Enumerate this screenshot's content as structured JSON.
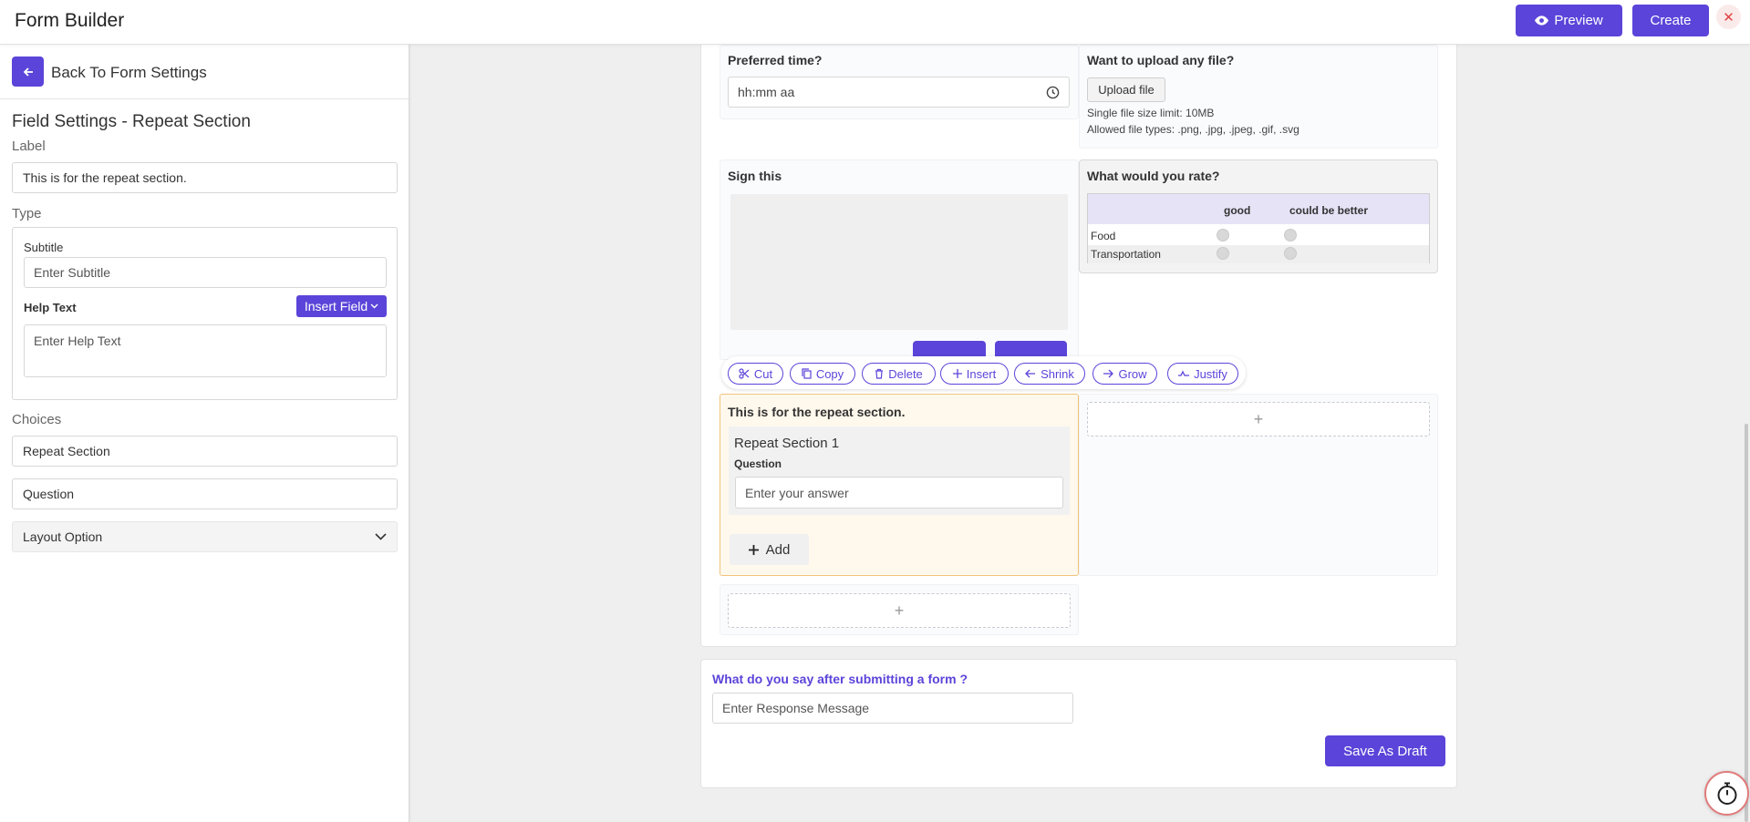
{
  "header": {
    "title": "Form Builder",
    "preview_label": "Preview",
    "create_label": "Create",
    "close_glyph": "✕"
  },
  "sidebar": {
    "back_label": "Back To Form Settings",
    "field_settings_title": "Field Settings - Repeat Section",
    "label_caption": "Label",
    "label_value": "This is for the repeat section.",
    "type_caption": "Type",
    "subtitle_caption": "Subtitle",
    "subtitle_placeholder": "Enter Subtitle",
    "help_text_caption": "Help Text",
    "insert_field_label": "Insert Field",
    "help_text_placeholder": "Enter Help Text",
    "choices_caption": "Choices",
    "choices": [
      "Repeat Section",
      "Question"
    ],
    "layout_option_label": "Layout Option"
  },
  "canvas": {
    "preferred_time": {
      "title": "Preferred time?",
      "value": "hh:mm aa"
    },
    "upload": {
      "title": "Want to upload any file?",
      "button_label": "Upload file",
      "size_limit": "Single file size limit: 10MB",
      "allowed_types": "Allowed file types: .png, .jpg, .jpeg, .gif, .svg"
    },
    "signature": {
      "title": "Sign this"
    },
    "rating": {
      "title": "What would you rate?",
      "columns": [
        "good",
        "could be better"
      ],
      "rows": [
        "Food",
        "Transportation"
      ]
    },
    "toolbar": {
      "cut": "Cut",
      "copy": "Copy",
      "delete": "Delete",
      "insert": "Insert",
      "shrink": "Shrink",
      "grow": "Grow",
      "justify": "Justify"
    },
    "repeat_section": {
      "title": "This is for the repeat section.",
      "section_label": "Repeat Section 1",
      "question_label": "Question",
      "answer_placeholder": "Enter your answer",
      "add_label": "Add"
    },
    "plus_glyph": "+"
  },
  "response": {
    "question": "What do you say after submitting a form ?",
    "placeholder": "Enter Response Message",
    "save_draft_label": "Save As Draft"
  },
  "colors": {
    "accent": "#5b44d9",
    "repeat_highlight": "#fff8ec",
    "repeat_border": "#f2c37d",
    "close_red": "#e04646"
  },
  "icons": {
    "preview": "eye-icon",
    "back": "arrow-left-icon",
    "insert_field": "chevron-down-icon",
    "layout_option": "chevron-down-icon",
    "time": "clock-icon",
    "cut": "scissors-icon",
    "copy": "copy-icon",
    "delete": "trash-icon",
    "insert": "plus-icon",
    "shrink": "arrow-left-icon",
    "grow": "arrow-right-icon",
    "justify": "justify-icon",
    "add": "plus-icon",
    "timer": "stopwatch-icon"
  }
}
